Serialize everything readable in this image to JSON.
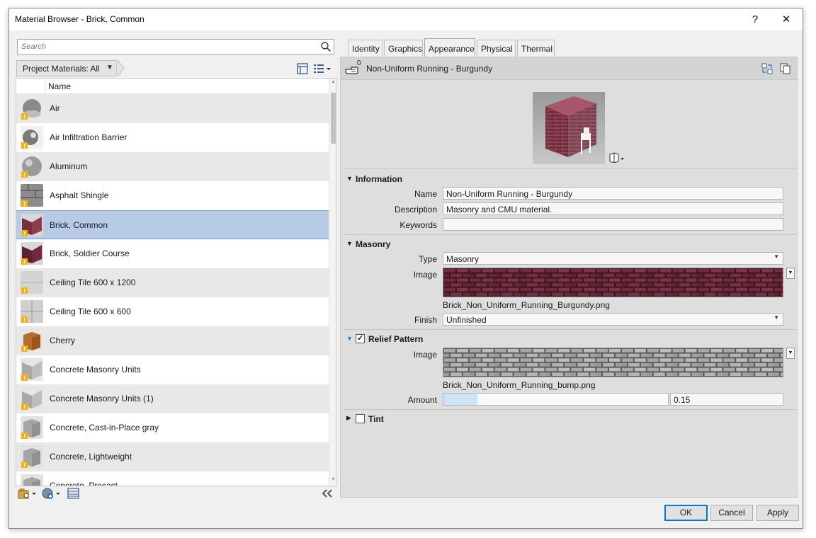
{
  "window": {
    "title": "Material Browser - Brick, Common",
    "help_label": "?",
    "close_label": "✕"
  },
  "search": {
    "placeholder": "Search"
  },
  "filter": {
    "label": "Project Materials: All"
  },
  "list": {
    "column_header": "Name",
    "items": [
      {
        "label": "Air",
        "thumb": "air"
      },
      {
        "label": "Air Infiltration Barrier",
        "thumb": "barrier"
      },
      {
        "label": "Aluminum",
        "thumb": "metal"
      },
      {
        "label": "Asphalt Shingle",
        "thumb": "shingle"
      },
      {
        "label": "Brick, Common",
        "thumb": "brick",
        "selected": true
      },
      {
        "label": "Brick, Soldier Course",
        "thumb": "brick2"
      },
      {
        "label": "Ceiling Tile 600 x 1200",
        "thumb": "tile"
      },
      {
        "label": "Ceiling Tile 600 x 600",
        "thumb": "tile2"
      },
      {
        "label": "Cherry",
        "thumb": "cherry"
      },
      {
        "label": "Concrete Masonry Units",
        "thumb": "cmu"
      },
      {
        "label": "Concrete Masonry Units (1)",
        "thumb": "cmu"
      },
      {
        "label": "Concrete, Cast-in-Place gray",
        "thumb": "concrete"
      },
      {
        "label": "Concrete, Lightweight",
        "thumb": "concrete"
      },
      {
        "label": "Concrete, Precast",
        "thumb": "concrete"
      }
    ]
  },
  "tabs": [
    {
      "label": "Identity"
    },
    {
      "label": "Graphics"
    },
    {
      "label": "Appearance",
      "active": true
    },
    {
      "label": "Physical"
    },
    {
      "label": "Thermal"
    }
  ],
  "asset": {
    "name": "Non-Uniform Running - Burgundy",
    "user_count": "0"
  },
  "information": {
    "title": "Information",
    "name_label": "Name",
    "name_value": "Non-Uniform Running - Burgundy",
    "description_label": "Description",
    "description_value": "Masonry and CMU material.",
    "keywords_label": "Keywords",
    "keywords_value": ""
  },
  "masonry": {
    "title": "Masonry",
    "type_label": "Type",
    "type_value": "Masonry",
    "image_label": "Image",
    "image_file": "Brick_Non_Uniform_Running_Burgundy.png",
    "finish_label": "Finish",
    "finish_value": "Unfinished"
  },
  "relief": {
    "title": "Relief Pattern",
    "enabled": true,
    "image_label": "Image",
    "image_file": "Brick_Non_Uniform_Running_bump.png",
    "amount_label": "Amount",
    "amount_value": "0.15",
    "amount_fraction": 0.15
  },
  "tint": {
    "title": "Tint",
    "enabled": false
  },
  "buttons": {
    "ok": "OK",
    "cancel": "Cancel",
    "apply": "Apply"
  },
  "colors": {
    "selection": "#b7cbe6",
    "brick": "#6b2a3a",
    "accent": "#0078d7"
  }
}
